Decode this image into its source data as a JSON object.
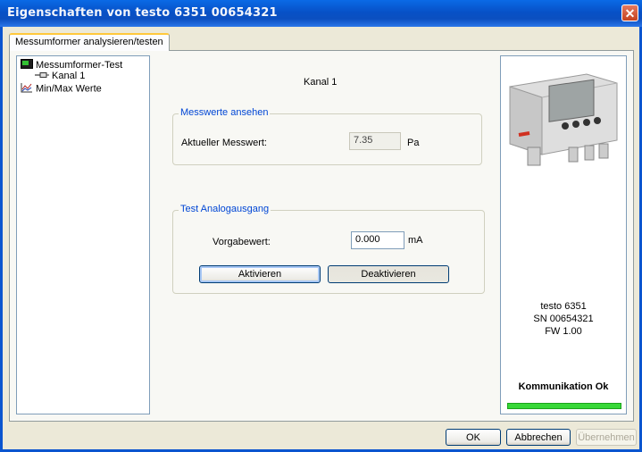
{
  "window": {
    "title": "Eigenschaften von testo 6351  00654321",
    "close_glyph": "✕"
  },
  "tabs": [
    {
      "label": "Messumformer analysieren/testen"
    }
  ],
  "tree": {
    "items": [
      {
        "label": "Messumformer-Test",
        "icon": "module-icon"
      },
      {
        "label": "Kanal 1",
        "icon": "channel-icon"
      },
      {
        "label": "Min/Max Werte",
        "icon": "chart-icon"
      }
    ]
  },
  "main": {
    "channel_heading": "Kanal 1",
    "measurement": {
      "legend": "Messwerte ansehen",
      "label": "Aktueller Messwert:",
      "value": "7.35",
      "unit": "Pa"
    },
    "analog_test": {
      "legend": "Test Analogausgang",
      "label": "Vorgabewert:",
      "value": "0.000",
      "unit": "mA",
      "activate_label": "Aktivieren",
      "deactivate_label": "Deaktivieren"
    }
  },
  "device": {
    "model": "testo 6351",
    "serial": "SN 00654321",
    "firmware": "FW  1.00",
    "status": "Kommunikation Ok",
    "status_color": "#37d837",
    "communication_level": 1.0
  },
  "footer": {
    "ok_label": "OK",
    "cancel_label": "Abbrechen",
    "apply_label": "Übernehmen"
  }
}
